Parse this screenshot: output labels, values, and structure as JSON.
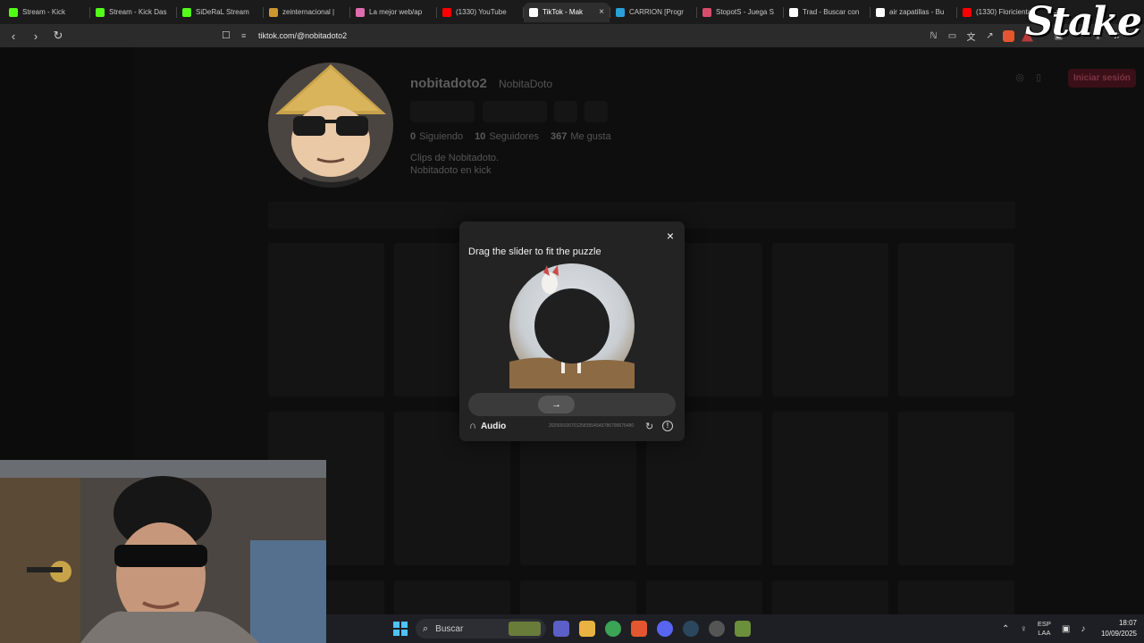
{
  "browser": {
    "tabs": [
      {
        "title": "Stream - Kick",
        "color": "#53fc18"
      },
      {
        "title": "Stream - Kick Das",
        "color": "#53fc18"
      },
      {
        "title": "SiDeRaL Stream",
        "color": "#53fc18"
      },
      {
        "title": "zeinternacional |",
        "color": "#c79a2c"
      },
      {
        "title": "La mejor web/ap",
        "color": "#e06bb0"
      },
      {
        "title": "(1330) YouTube",
        "color": "#ff0000"
      },
      {
        "title": "TikTok - Mak",
        "color": "#ffffff",
        "active": true
      },
      {
        "title": "CARRION [Progr",
        "color": "#2a9fd8"
      },
      {
        "title": "StopotS - Juega S",
        "color": "#d94b6a"
      },
      {
        "title": "Trad - Buscar con",
        "color": "#ffffff"
      },
      {
        "title": "air zapatillas - Bu",
        "color": "#ffffff"
      },
      {
        "title": "(1330) Floricienta",
        "color": "#ff0000"
      }
    ],
    "new_tab": "+",
    "close_tab": "×",
    "url": "tiktok.com/@nobitadoto2"
  },
  "overlay": {
    "stake_logo": "Stake"
  },
  "profile": {
    "username": "nobitadoto2",
    "nickname": "NobitaDoto",
    "stats": [
      {
        "num": "0",
        "label": "Siguiendo"
      },
      {
        "num": "10",
        "label": "Seguidores"
      },
      {
        "num": "367",
        "label": "Me gusta"
      }
    ],
    "bio_line1": "Clips de Nobitadoto.",
    "bio_line2": "Nobitadoto en kick",
    "login_label": "Iniciar sesión"
  },
  "captcha": {
    "title": "Drag the slider to fit the puzzle",
    "close": "×",
    "audio_label": "Audio",
    "id_text": "20250910070125835545A5786790676480",
    "slider_position": 0.41
  },
  "taskbar": {
    "search_placeholder": "Buscar",
    "lang_top": "ESP",
    "lang_bottom": "LAA",
    "time": "18:07",
    "date": "10/09/2025"
  }
}
